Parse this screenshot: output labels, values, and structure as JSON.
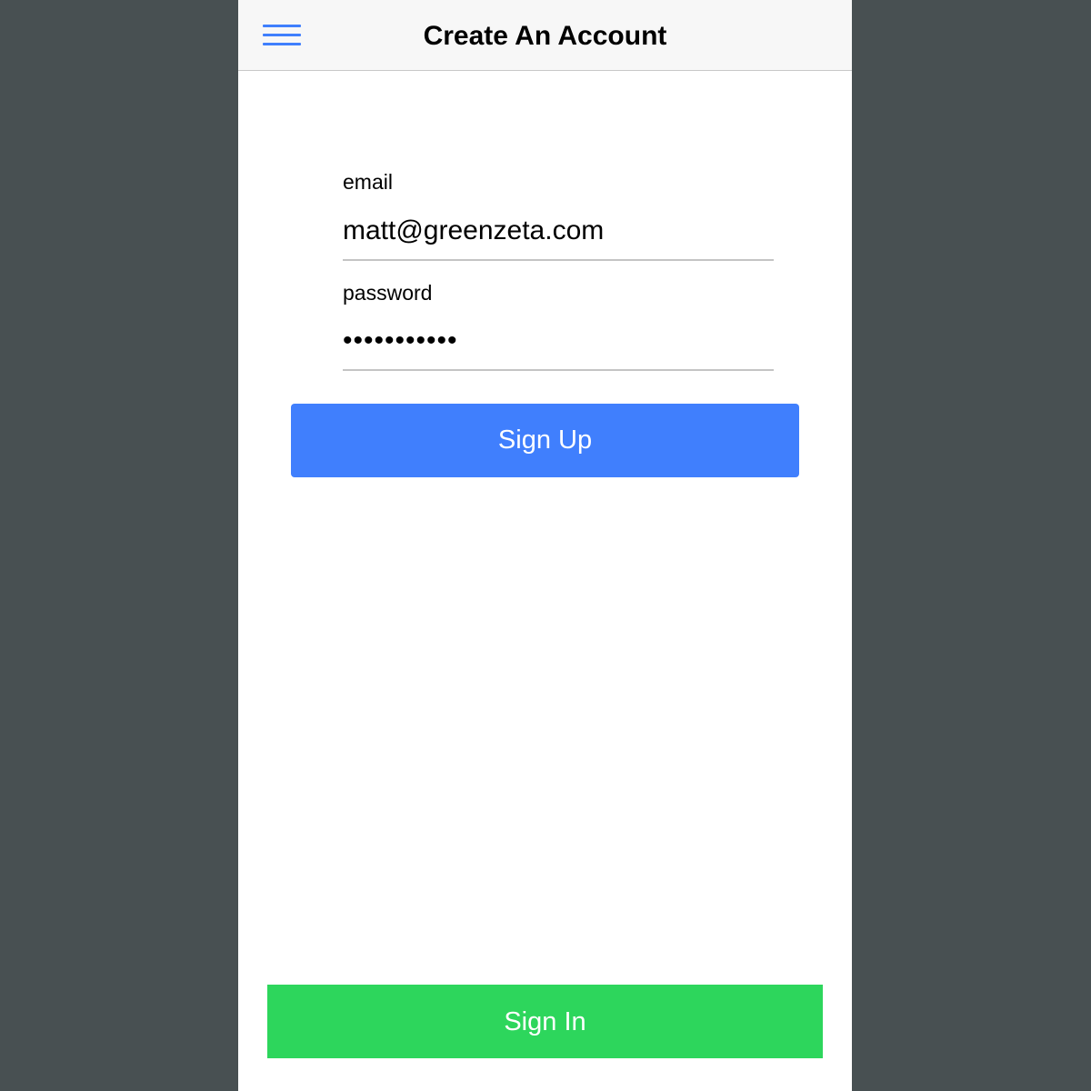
{
  "header": {
    "title": "Create An Account",
    "menu_icon": "hamburger-menu-icon"
  },
  "form": {
    "email": {
      "label": "email",
      "value": "matt@greenzeta.com"
    },
    "password": {
      "label": "password",
      "value": "•••••••••••"
    }
  },
  "actions": {
    "signup_label": "Sign Up",
    "signin_label": "Sign In"
  },
  "colors": {
    "background": "#485052",
    "accent_blue": "#407ffd",
    "accent_green": "#2dd65c",
    "nav_background": "#f7f7f7"
  }
}
